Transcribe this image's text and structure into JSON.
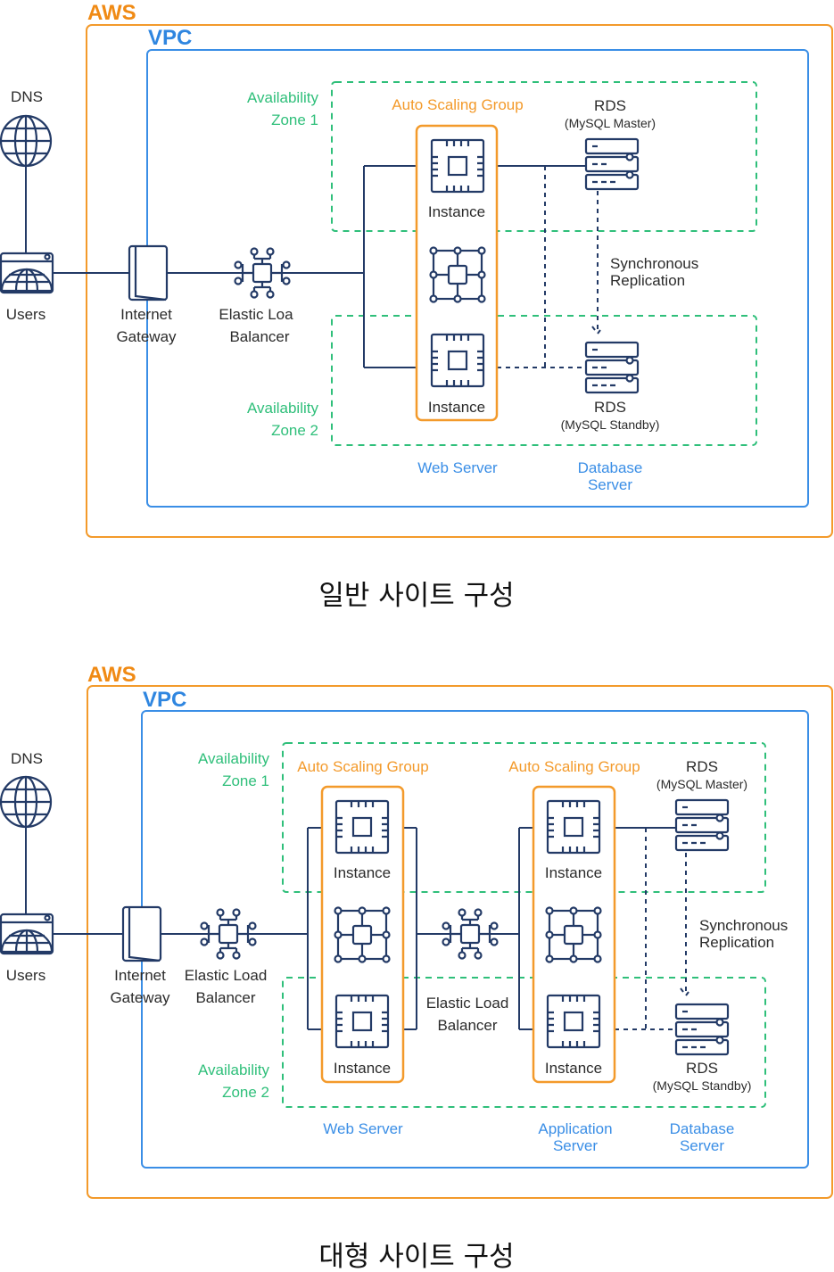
{
  "colors": {
    "aws": "#f08a14",
    "vpc": "#2f86e0",
    "availability_zone": "#2fbf7a",
    "auto_scaling_group": "#f39a2b",
    "server_tier": "#3a8ee6",
    "icon_line": "#233a66"
  },
  "diagrams": [
    {
      "caption": "일반 사이트 구성",
      "aws_label": "AWS",
      "vpc_label": "VPC",
      "dns_label": "DNS",
      "users_label": "Users",
      "igw_label": [
        "Internet",
        "Gateway"
      ],
      "elb_label": [
        "Elastic Loa",
        "Balancer"
      ],
      "az1_label": [
        "Availability",
        "Zone 1"
      ],
      "az2_label": [
        "Availability",
        "Zone 2"
      ],
      "asg_label": "Auto Scaling Group",
      "instance_label": "Instance",
      "rds_master": [
        "RDS",
        "(MySQL Master)"
      ],
      "rds_standby": [
        "RDS",
        "(MySQL Standby)"
      ],
      "replication_label": [
        "Synchronous",
        "Replication"
      ],
      "tiers": {
        "web": [
          "Web Server"
        ],
        "db": [
          "Database",
          "Server"
        ]
      }
    },
    {
      "caption": "대형 사이트 구성",
      "aws_label": "AWS",
      "vpc_label": "VPC",
      "dns_label": "DNS",
      "users_label": "Users",
      "igw_label": [
        "Internet",
        "Gateway"
      ],
      "elb_label": [
        "Elastic Load",
        "Balancer"
      ],
      "elb2_label": [
        "Elastic Load",
        "Balancer"
      ],
      "az1_label": [
        "Availability",
        "Zone 1"
      ],
      "az2_label": [
        "Availability",
        "Zone 2"
      ],
      "asg_label": "Auto Scaling Group",
      "asg2_label": "Auto Scaling Group",
      "instance_label": "Instance",
      "rds_master": [
        "RDS",
        "(MySQL Master)"
      ],
      "rds_standby": [
        "RDS",
        "(MySQL Standby)"
      ],
      "replication_label": [
        "Synchronous",
        "Replication"
      ],
      "tiers": {
        "web": [
          "Web Server"
        ],
        "app": [
          "Application",
          "Server"
        ],
        "db": [
          "Database",
          "Server"
        ]
      }
    }
  ]
}
